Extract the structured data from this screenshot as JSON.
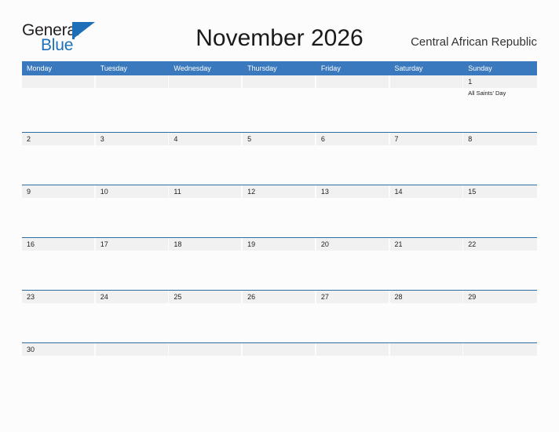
{
  "brand": {
    "name_part1": "General",
    "name_part2": "Blue",
    "flag_icon": "flag-icon",
    "accent_color": "#1d70b8"
  },
  "header": {
    "title": "November 2026",
    "region": "Central African Republic"
  },
  "calendar": {
    "header_bg": "#3a79bd",
    "row_border_color": "#2e6da4",
    "date_band_color": "#f1f1f1",
    "weekdays": [
      "Monday",
      "Tuesday",
      "Wednesday",
      "Thursday",
      "Friday",
      "Saturday",
      "Sunday"
    ],
    "weeks": [
      [
        {
          "date": "",
          "event": ""
        },
        {
          "date": "",
          "event": ""
        },
        {
          "date": "",
          "event": ""
        },
        {
          "date": "",
          "event": ""
        },
        {
          "date": "",
          "event": ""
        },
        {
          "date": "",
          "event": ""
        },
        {
          "date": "1",
          "event": "All Saints' Day"
        }
      ],
      [
        {
          "date": "2",
          "event": ""
        },
        {
          "date": "3",
          "event": ""
        },
        {
          "date": "4",
          "event": ""
        },
        {
          "date": "5",
          "event": ""
        },
        {
          "date": "6",
          "event": ""
        },
        {
          "date": "7",
          "event": ""
        },
        {
          "date": "8",
          "event": ""
        }
      ],
      [
        {
          "date": "9",
          "event": ""
        },
        {
          "date": "10",
          "event": ""
        },
        {
          "date": "11",
          "event": ""
        },
        {
          "date": "12",
          "event": ""
        },
        {
          "date": "13",
          "event": ""
        },
        {
          "date": "14",
          "event": ""
        },
        {
          "date": "15",
          "event": ""
        }
      ],
      [
        {
          "date": "16",
          "event": ""
        },
        {
          "date": "17",
          "event": ""
        },
        {
          "date": "18",
          "event": ""
        },
        {
          "date": "19",
          "event": ""
        },
        {
          "date": "20",
          "event": ""
        },
        {
          "date": "21",
          "event": ""
        },
        {
          "date": "22",
          "event": ""
        }
      ],
      [
        {
          "date": "23",
          "event": ""
        },
        {
          "date": "24",
          "event": ""
        },
        {
          "date": "25",
          "event": ""
        },
        {
          "date": "26",
          "event": ""
        },
        {
          "date": "27",
          "event": ""
        },
        {
          "date": "28",
          "event": ""
        },
        {
          "date": "29",
          "event": ""
        }
      ],
      [
        {
          "date": "30",
          "event": ""
        },
        {
          "date": "",
          "event": ""
        },
        {
          "date": "",
          "event": ""
        },
        {
          "date": "",
          "event": ""
        },
        {
          "date": "",
          "event": ""
        },
        {
          "date": "",
          "event": ""
        },
        {
          "date": "",
          "event": ""
        }
      ]
    ]
  }
}
